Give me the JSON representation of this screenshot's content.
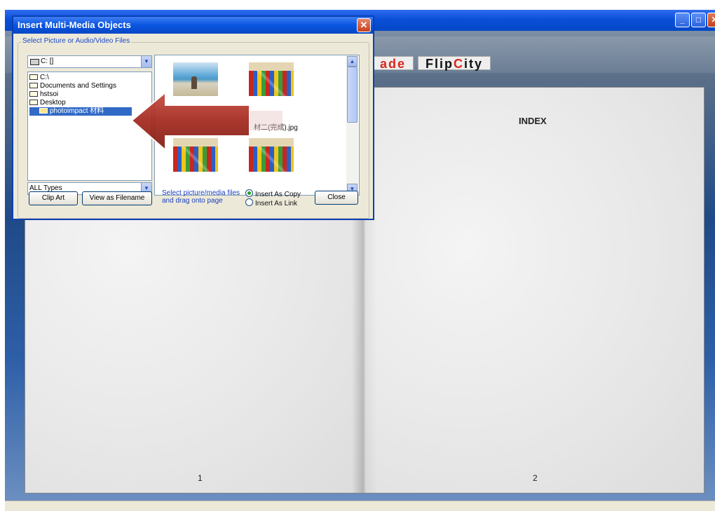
{
  "app": {
    "brand": {
      "seg1": "ade",
      "seg2_flip": "Flip",
      "seg2_city_c": "C",
      "seg2_ity": "ity"
    },
    "book": {
      "left_page_number": "1",
      "right_page_number": "2",
      "right_page_title": "INDEX"
    },
    "window_buttons": {
      "minimize": "_",
      "maximize": "□",
      "close": "✕"
    }
  },
  "dialog": {
    "title": "Insert Multi-Media Objects",
    "close_glyph": "✕",
    "group_legend": "Select Picture or Audio/Video Files",
    "drive": {
      "value": "C: []",
      "icon": "drive-icon"
    },
    "tree": [
      {
        "label": "C:\\",
        "selected": false
      },
      {
        "label": "Documents and Settings",
        "selected": false
      },
      {
        "label": "hstsoi",
        "selected": false
      },
      {
        "label": "Desktop",
        "selected": false
      },
      {
        "label": "photoimpact 材料",
        "selected": true
      }
    ],
    "file_type": {
      "value": "ALL Types"
    },
    "preview": {
      "visible_filename": "材二(完成).jpg"
    },
    "buttons": {
      "clip_art": "Clip Art",
      "view_as_filename": "View as Filename",
      "close": "Close"
    },
    "hint_line1": "Select picture/media files",
    "hint_line2": "and drag onto page",
    "insert_options": [
      {
        "label": "Insert As Copy",
        "selected": true
      },
      {
        "label": "Insert As Link",
        "selected": false
      }
    ]
  },
  "colors": {
    "accent_blue": "#0a55e0",
    "selection": "#316ac5",
    "arrow": "#a3261c"
  }
}
